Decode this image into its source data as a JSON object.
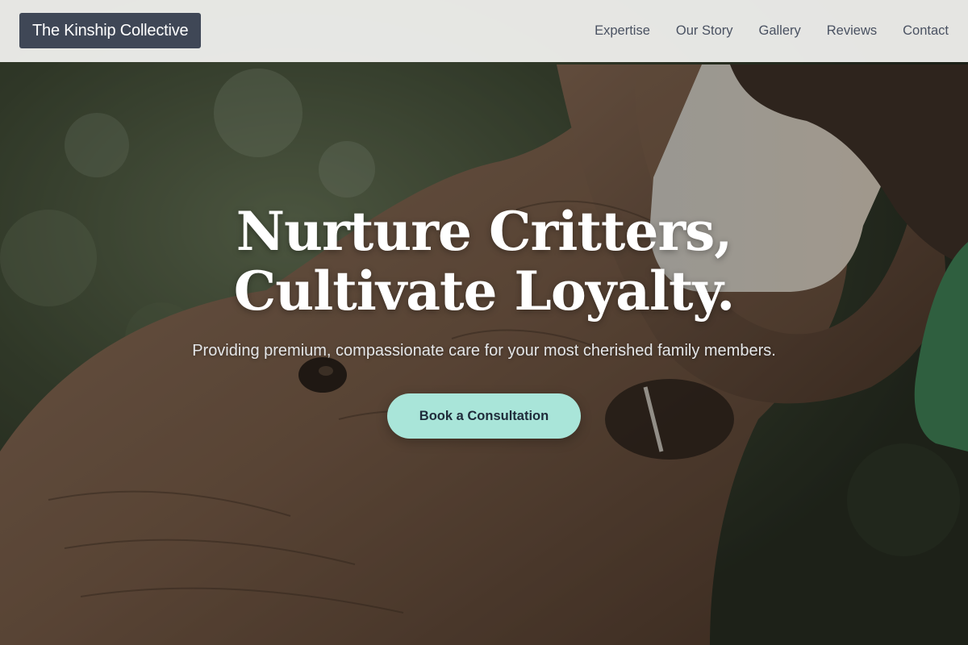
{
  "header": {
    "brand": "The Kinship Collective",
    "nav": [
      {
        "label": "Expertise"
      },
      {
        "label": "Our Story"
      },
      {
        "label": "Gallery"
      },
      {
        "label": "Reviews"
      },
      {
        "label": "Contact"
      }
    ]
  },
  "hero": {
    "title_line_1": "Nurture Critters,",
    "title_line_2": "Cultivate Loyalty.",
    "subtitle": "Providing premium, compassionate care for your most cherished family members.",
    "cta_label": "Book a Consultation",
    "background_image": "elephant-feeding-photo"
  },
  "colors": {
    "header_bg": "#f4f4f2",
    "logo_bg": "#3f4756",
    "nav_text": "#4a5262",
    "cta_bg": "#a9e5d9",
    "cta_text": "#1f2b3a"
  }
}
